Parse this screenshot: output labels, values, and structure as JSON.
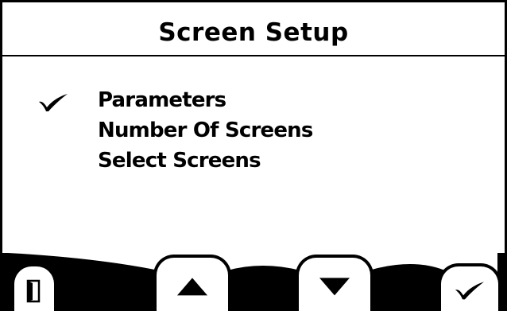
{
  "screen": {
    "title": "Screen Setup"
  },
  "menu": {
    "items": [
      {
        "label": "Parameters",
        "checked": true
      },
      {
        "label": "Number Of Screens",
        "checked": false
      },
      {
        "label": "Select Screens",
        "checked": false
      }
    ],
    "check_icon": "checkmark-icon"
  },
  "softkeys": [
    {
      "name": "exit",
      "icon": "door-exit-icon"
    },
    {
      "name": "up",
      "icon": "triangle-up-icon"
    },
    {
      "name": "down",
      "icon": "triangle-down-icon"
    },
    {
      "name": "ok",
      "icon": "checkmark-icon"
    }
  ]
}
